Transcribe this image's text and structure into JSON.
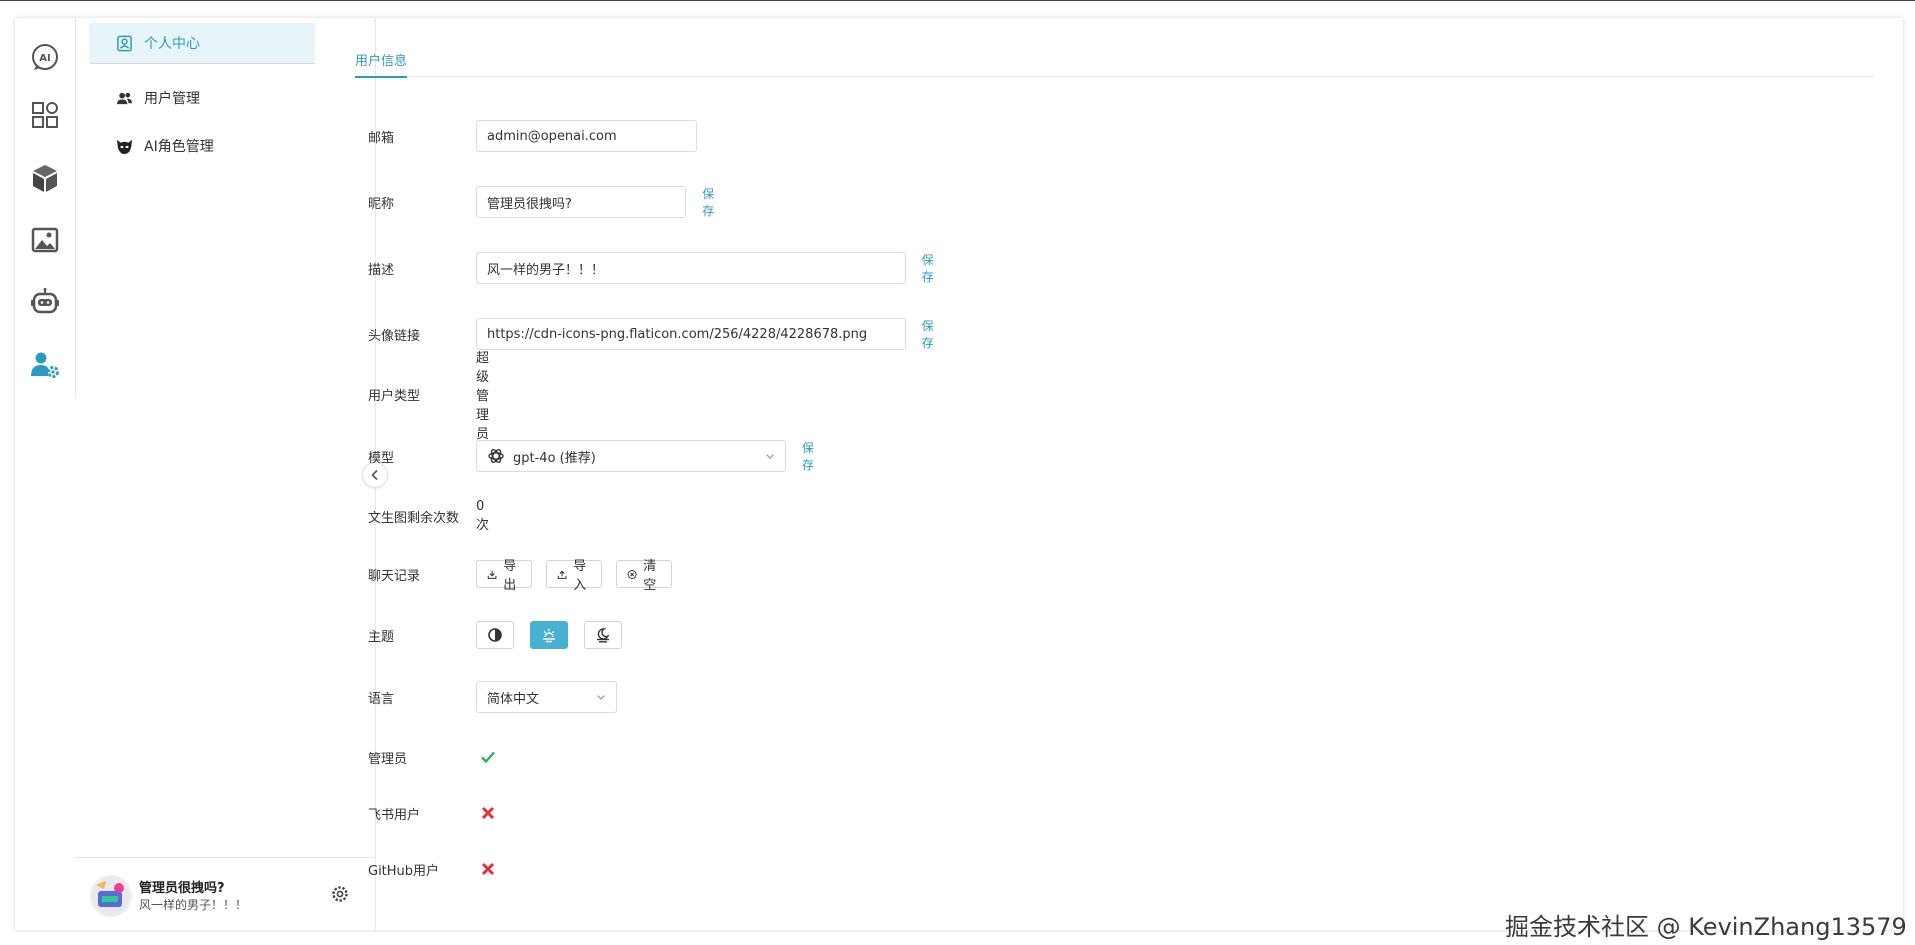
{
  "colors": {
    "accent": "#2d9bbf",
    "success": "#2bb34b",
    "danger": "#e0313a"
  },
  "rail": {
    "items": [
      {
        "icon": "ai-chat-icon"
      },
      {
        "icon": "apps-grid-icon"
      },
      {
        "icon": "cube-icon"
      },
      {
        "icon": "image-icon"
      },
      {
        "icon": "robot-icon"
      },
      {
        "icon": "user-settings-icon"
      }
    ]
  },
  "subnav": {
    "items": [
      {
        "label": "个人中心",
        "icon": "profile-icon"
      },
      {
        "label": "用户管理",
        "icon": "users-icon"
      },
      {
        "label": "AI角色管理",
        "icon": "mask-icon"
      }
    ]
  },
  "user": {
    "name": "管理员很拽吗?",
    "desc": "风一样的男子！！！"
  },
  "tabs": [
    {
      "label": "用户信息"
    }
  ],
  "form": {
    "email": {
      "label": "邮箱",
      "value": "admin@openai.com"
    },
    "nickname": {
      "label": "昵称",
      "value": "管理员很拽吗?",
      "save": "保存"
    },
    "desc": {
      "label": "描述",
      "value": "风一样的男子！！！",
      "save": "保存"
    },
    "avatar": {
      "label": "头像链接",
      "value": "https://cdn-icons-png.flaticon.com/256/4228/4228678.png",
      "save": "保存"
    },
    "user_type": {
      "label": "用户类型",
      "value": "超级管理员"
    },
    "model": {
      "label": "模型",
      "value": "gpt-4o (推荐)",
      "save": "保存"
    },
    "image_quota": {
      "label": "文生图剩余次数",
      "value": "0 次"
    },
    "chat_history": {
      "label": "聊天记录",
      "export": "导出",
      "import": "导入",
      "clear": "清空"
    },
    "theme": {
      "label": "主题",
      "selected": "light"
    },
    "language": {
      "label": "语言",
      "value": "简体中文"
    },
    "admin": {
      "label": "管理员",
      "value": true
    },
    "feishu": {
      "label": "飞书用户",
      "value": false
    },
    "github": {
      "label": "GitHub用户",
      "value": false
    }
  },
  "watermark": "掘金技术社区 @ KevinZhang13579"
}
